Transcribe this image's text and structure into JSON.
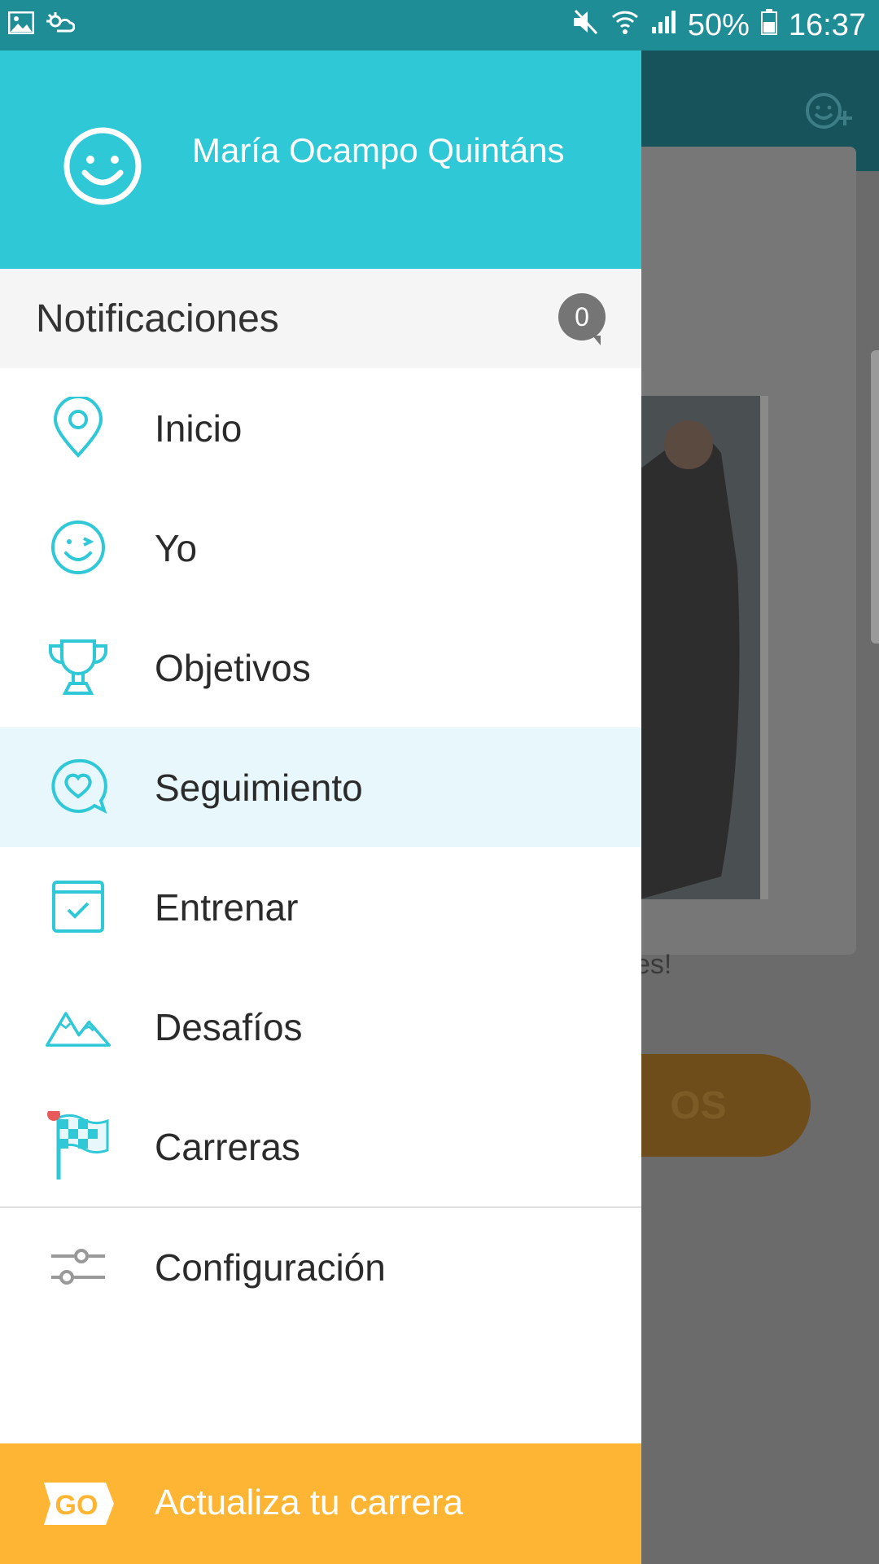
{
  "status_bar": {
    "battery_percent": "50%",
    "time": "16:37"
  },
  "drawer": {
    "user_name": "María Ocampo Quintáns",
    "notifications": {
      "label": "Notificaciones",
      "count": "0"
    },
    "menu": [
      {
        "label": "Inicio",
        "icon": "location-pin-icon"
      },
      {
        "label": "Yo",
        "icon": "wink-face-icon"
      },
      {
        "label": "Objetivos",
        "icon": "trophy-icon"
      },
      {
        "label": "Seguimiento",
        "icon": "heart-bubble-icon",
        "active": true
      },
      {
        "label": "Entrenar",
        "icon": "calendar-check-icon"
      },
      {
        "label": "Desafíos",
        "icon": "mountain-icon"
      },
      {
        "label": "Carreras",
        "icon": "checkered-flag-icon"
      }
    ],
    "settings_label": "Configuración",
    "footer_label": "Actualiza tu carrera",
    "footer_badge": "GO"
  },
  "background": {
    "card_text_fragment": "es!",
    "button_text_fragment": "OS"
  },
  "colors": {
    "accent": "#2ec8d6",
    "footer": "#ffb534",
    "active_row": "#e8f7fb"
  }
}
